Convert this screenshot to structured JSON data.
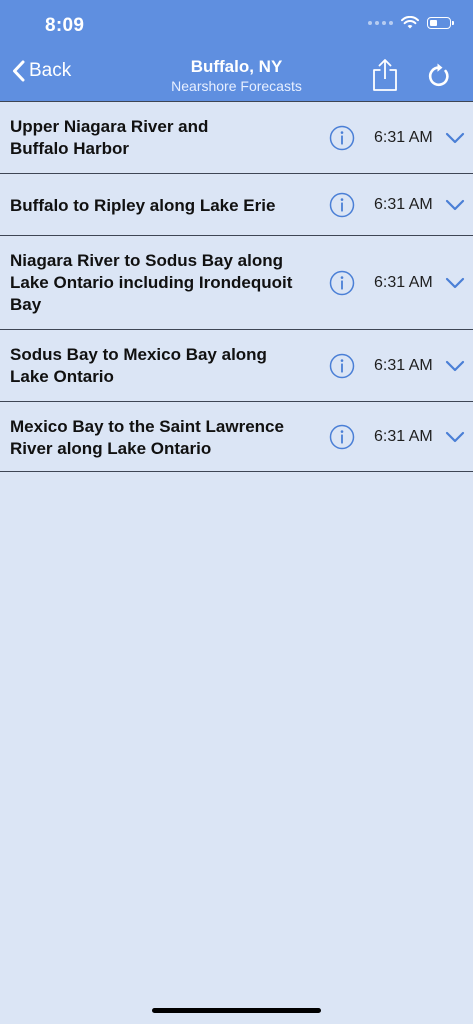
{
  "status": {
    "time": "8:09"
  },
  "nav": {
    "back_label": "Back",
    "title": "Buffalo, NY",
    "subtitle": "Nearshore Forecasts"
  },
  "colors": {
    "header": "#5f8fe0",
    "background": "#dbe5f5",
    "accent": "#4a7fd6"
  },
  "forecasts": [
    {
      "title_lines": [
        "Upper Niagara River and",
        "Buffalo Harbor"
      ],
      "time": "6:31 AM"
    },
    {
      "title_lines": [
        "Buffalo to Ripley along Lake Erie"
      ],
      "time": "6:31 AM"
    },
    {
      "title_lines": [
        "Niagara River to Sodus Bay along",
        "Lake Ontario including Irondequoit",
        "Bay"
      ],
      "time": "6:31 AM"
    },
    {
      "title_lines": [
        "Sodus Bay to Mexico Bay along",
        "Lake Ontario"
      ],
      "time": "6:31 AM"
    },
    {
      "title_lines": [
        "Mexico Bay to the Saint Lawrence",
        "River along Lake Ontario"
      ],
      "time": "6:31 AM"
    }
  ],
  "icons": {
    "info": "info-circle-icon",
    "expand": "chevron-down-icon",
    "share": "share-icon",
    "refresh": "refresh-icon",
    "back": "chevron-left-icon"
  }
}
